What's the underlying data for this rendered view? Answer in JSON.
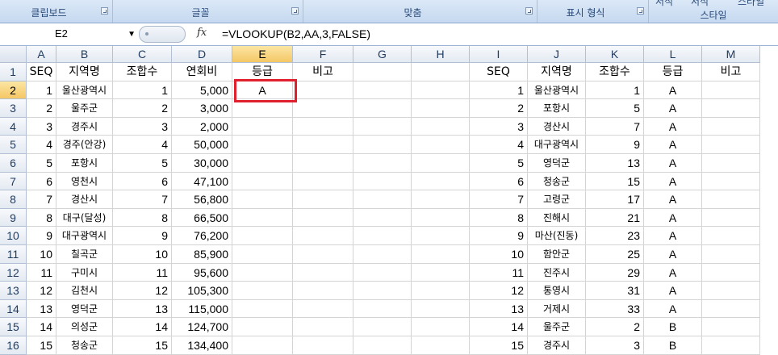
{
  "ribbon": {
    "groups": [
      {
        "label": "클립보드"
      },
      {
        "label": "글꼴"
      },
      {
        "label": "맞춤"
      },
      {
        "label": "표시 형식"
      },
      {
        "label": "스타일"
      }
    ],
    "top_cut_labels": [
      "서식",
      "서식",
      "스타일"
    ]
  },
  "formula_bar": {
    "name_box": "E2",
    "fx_label": "fx",
    "formula": "=VLOOKUP(B2,AA,3,FALSE)"
  },
  "columns": [
    "A",
    "B",
    "C",
    "D",
    "E",
    "F",
    "G",
    "H",
    "I",
    "J",
    "K",
    "L",
    "M"
  ],
  "row_numbers": [
    "1",
    "2",
    "3",
    "4",
    "5",
    "6",
    "7",
    "8",
    "9",
    "10",
    "11",
    "12",
    "13",
    "14",
    "15",
    "16"
  ],
  "selected": {
    "column": "E",
    "row": "2"
  },
  "left_table": {
    "headers": [
      "SEQ",
      "지역명",
      "조합수",
      "연회비",
      "등급",
      "비고"
    ],
    "rows": [
      [
        "1",
        "울산광역시",
        "1",
        "5,000",
        "A",
        ""
      ],
      [
        "2",
        "울주군",
        "2",
        "3,000",
        "",
        ""
      ],
      [
        "3",
        "경주시",
        "3",
        "2,000",
        "",
        ""
      ],
      [
        "4",
        "경주(안강)",
        "4",
        "50,000",
        "",
        ""
      ],
      [
        "5",
        "포항시",
        "5",
        "30,000",
        "",
        ""
      ],
      [
        "6",
        "영천시",
        "6",
        "47,100",
        "",
        ""
      ],
      [
        "7",
        "경산시",
        "7",
        "56,800",
        "",
        ""
      ],
      [
        "8",
        "대구(달성)",
        "8",
        "66,500",
        "",
        ""
      ],
      [
        "9",
        "대구광역시",
        "9",
        "76,200",
        "",
        ""
      ],
      [
        "10",
        "칠곡군",
        "10",
        "85,900",
        "",
        ""
      ],
      [
        "11",
        "구미시",
        "11",
        "95,600",
        "",
        ""
      ],
      [
        "12",
        "김천시",
        "12",
        "105,300",
        "",
        ""
      ],
      [
        "13",
        "영덕군",
        "13",
        "115,000",
        "",
        ""
      ],
      [
        "14",
        "의성군",
        "14",
        "124,700",
        "",
        ""
      ],
      [
        "15",
        "청송군",
        "15",
        "134,400",
        "",
        ""
      ]
    ]
  },
  "right_table": {
    "headers": [
      "SEQ",
      "지역명",
      "조합수",
      "등급",
      "비고"
    ],
    "rows": [
      [
        "1",
        "울산광역시",
        "1",
        "A",
        ""
      ],
      [
        "2",
        "포항시",
        "5",
        "A",
        ""
      ],
      [
        "3",
        "경산시",
        "7",
        "A",
        ""
      ],
      [
        "4",
        "대구광역시",
        "9",
        "A",
        ""
      ],
      [
        "5",
        "영덕군",
        "13",
        "A",
        ""
      ],
      [
        "6",
        "청송군",
        "15",
        "A",
        ""
      ],
      [
        "7",
        "고령군",
        "17",
        "A",
        ""
      ],
      [
        "8",
        "진해시",
        "21",
        "A",
        ""
      ],
      [
        "9",
        "마산(진동)",
        "23",
        "A",
        ""
      ],
      [
        "10",
        "함안군",
        "25",
        "A",
        ""
      ],
      [
        "11",
        "진주시",
        "29",
        "A",
        ""
      ],
      [
        "12",
        "통영시",
        "31",
        "A",
        ""
      ],
      [
        "13",
        "거제시",
        "33",
        "A",
        ""
      ],
      [
        "14",
        "울주군",
        "2",
        "B",
        ""
      ],
      [
        "15",
        "경주시",
        "3",
        "B",
        ""
      ]
    ]
  }
}
